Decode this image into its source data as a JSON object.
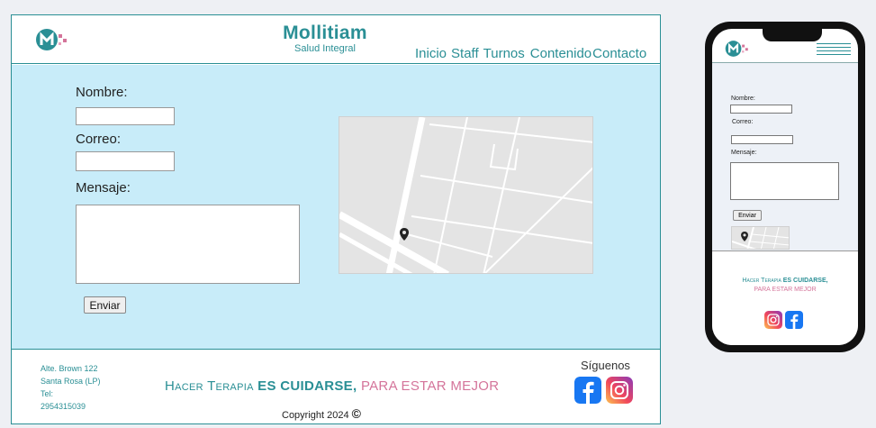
{
  "brand": {
    "name": "Mollitiam",
    "subtitle": "Salud Integral"
  },
  "nav": [
    "Inicio",
    "Staff",
    "Turnos",
    "Contenido",
    "Contacto"
  ],
  "form": {
    "name_label": "Nombre:",
    "email_label": "Correo:",
    "message_label": "Mensaje:",
    "submit_label": "Enviar"
  },
  "footer": {
    "address_line1": "Alte. Brown 122",
    "address_line2": "Santa Rosa (LP)",
    "phone_label": "Tel:",
    "phone": "2954315039",
    "tagline_part1": "Hacer Terapia",
    "tagline_part2": "ES CUIDARSE,",
    "tagline_part3": "PARA ESTAR MEJOR",
    "copyright": "Copyright 2024",
    "copyright_symbol": "©",
    "follow": "Síguenos"
  },
  "mobile": {
    "name_label": "Nombre:",
    "email_label": "Correo:",
    "message_label": "Mensaje:",
    "submit_label": "Enviar",
    "tagline_line1a": "Hacer Terapia",
    "tagline_line1b": "ES CUIDARSE,",
    "tagline_line2": "PARA ESTAR MEJOR"
  },
  "colors": {
    "accent": "#2a8f95",
    "content_bg": "#c8ecf9",
    "pink": "#d4749a",
    "facebook": "#1877f2"
  },
  "icons": [
    "logo-icon",
    "map-pin-icon",
    "facebook-icon",
    "instagram-icon",
    "hamburger-menu-icon"
  ]
}
